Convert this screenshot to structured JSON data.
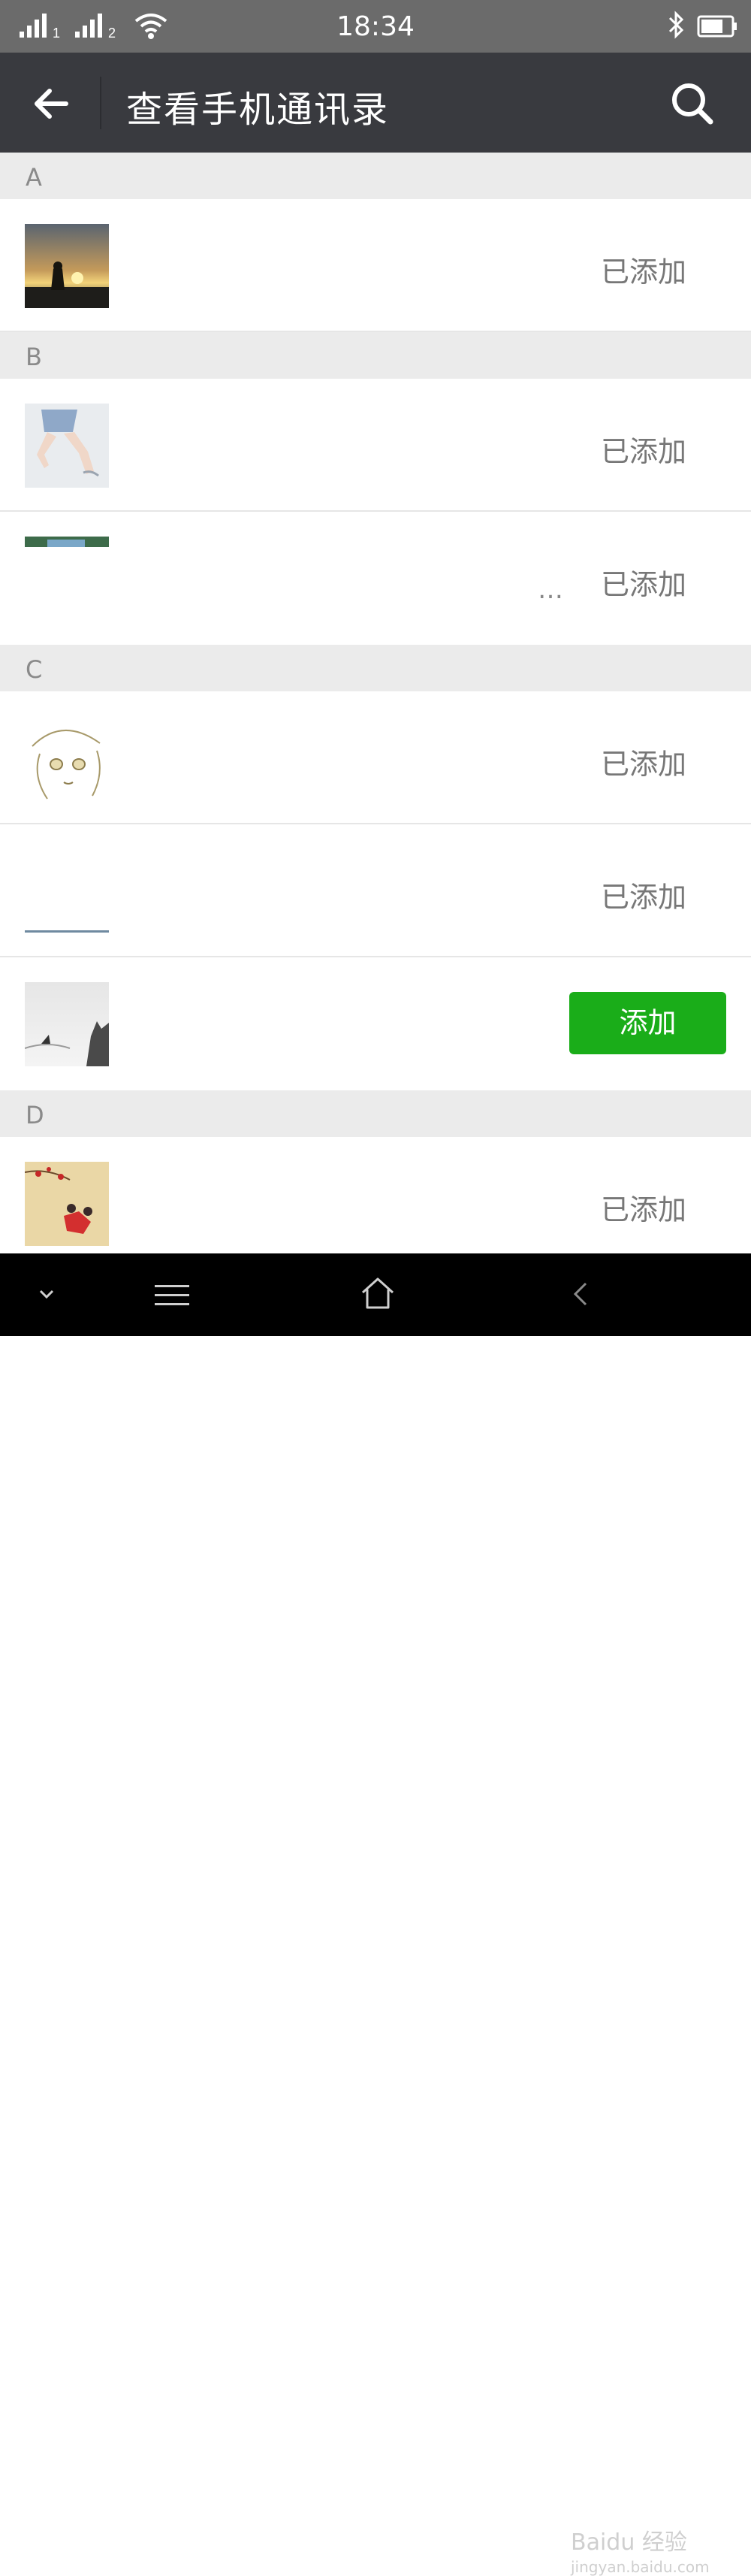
{
  "status_bar": {
    "time": "18:34",
    "sim1": "1",
    "sim2": "2"
  },
  "header": {
    "title": "查看手机通讯录"
  },
  "sections": [
    {
      "letter": "A"
    },
    {
      "letter": "B"
    },
    {
      "letter": "C"
    },
    {
      "letter": "D"
    }
  ],
  "contacts": [
    {
      "status": "已添加"
    },
    {
      "status": "已添加"
    },
    {
      "status": "已添加"
    },
    {
      "status": "已添加"
    },
    {
      "status": "已添加"
    },
    {
      "action": "添加"
    },
    {
      "status": "已添加"
    }
  ],
  "ellipsis": "…",
  "watermark": {
    "brand": "Baidu 经验",
    "url": "jingyan.baidu.com"
  },
  "colors": {
    "add_button": "#1aad19",
    "header_bg": "#393a3f",
    "section_bg": "#ebebeb"
  }
}
